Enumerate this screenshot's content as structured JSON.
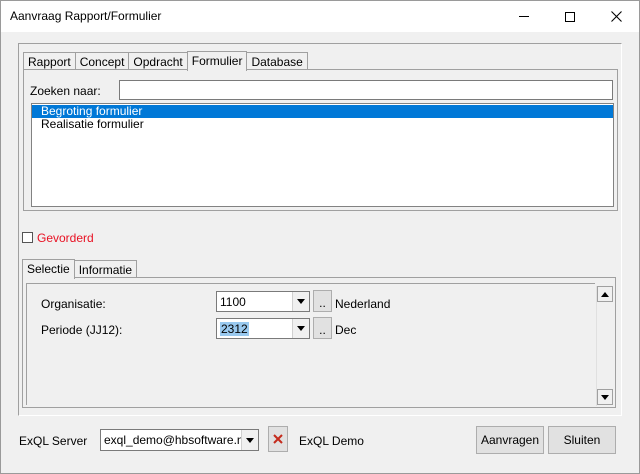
{
  "window": {
    "title": "Aanvraag Rapport/Formulier"
  },
  "main_tabs": [
    {
      "label": "Rapport",
      "active": false
    },
    {
      "label": "Concept",
      "active": false
    },
    {
      "label": "Opdracht",
      "active": false
    },
    {
      "label": "Formulier",
      "active": true
    },
    {
      "label": "Database",
      "active": false
    }
  ],
  "search": {
    "label": "Zoeken naar:",
    "value": ""
  },
  "form_list": [
    {
      "label": "Begroting formulier",
      "selected": true
    },
    {
      "label": "Realisatie formulier",
      "selected": false
    }
  ],
  "advanced": {
    "label": "Gevorderd",
    "checked": false,
    "color": "#e81123"
  },
  "sub_tabs": [
    {
      "label": "Selectie",
      "active": true
    },
    {
      "label": "Informatie",
      "active": false
    }
  ],
  "params": {
    "organisatie": {
      "label": "Organisatie:",
      "value": "1100",
      "browse_label": "..",
      "description": "Nederland"
    },
    "periode": {
      "label": "Periode (JJ12):",
      "value": "2312",
      "browse_label": "..",
      "description": "Dec"
    }
  },
  "footer": {
    "server_label": "ExQL Server",
    "server_value": "exql_demo@hbsoftware.nl",
    "server_name": "ExQL Demo",
    "request_button": "Aanvragen",
    "close_button": "Sluiten"
  },
  "colors": {
    "selection": "#0078d7",
    "text_highlight": "#99c9ef",
    "delete_icon": "#c42b1c"
  }
}
